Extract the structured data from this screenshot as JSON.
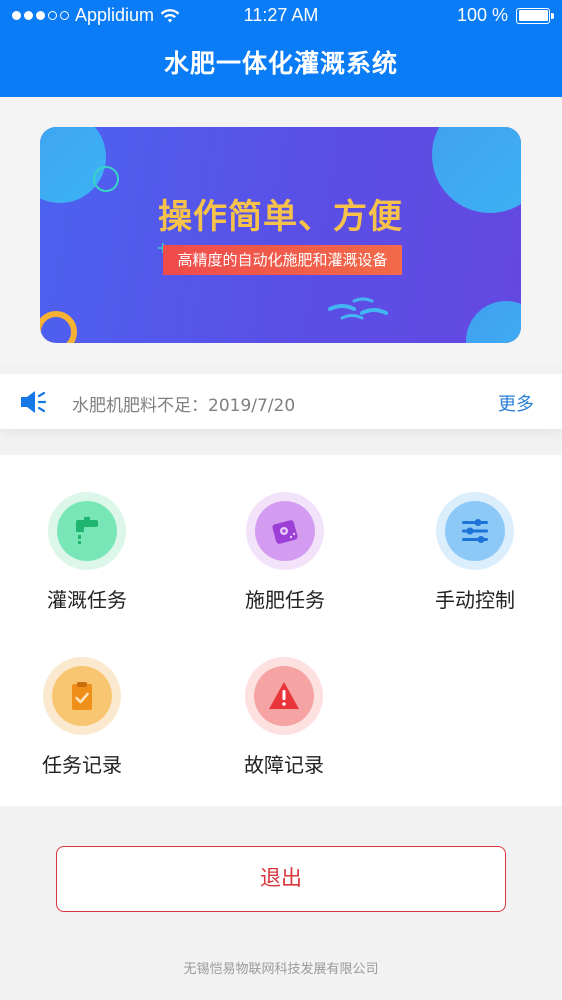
{
  "status_bar": {
    "carrier": "Applidium",
    "time": "11:27 AM",
    "battery": "100 %"
  },
  "header": {
    "title": "水肥一体化灌溉系统"
  },
  "banner": {
    "title": "操作简单、方便",
    "subtitle": "高精度的自动化施肥和灌溉设备"
  },
  "notice": {
    "icon": "speaker-icon",
    "message": "水肥机肥料不足：2019/7/20",
    "more": "更多"
  },
  "menu": [
    {
      "label": "灌溉任务",
      "icon": "faucet-icon"
    },
    {
      "label": "施肥任务",
      "icon": "fertilizer-icon"
    },
    {
      "label": "手动控制",
      "icon": "sliders-icon"
    },
    {
      "label": "任务记录",
      "icon": "clipboard-icon"
    },
    {
      "label": "故障记录",
      "icon": "warning-icon"
    }
  ],
  "logout_label": "退出",
  "footer": "无锡恺易物联网科技发展有限公司",
  "colors": {
    "header": "#0a7cf5",
    "accent_red": "#d9363e",
    "link_blue": "#2a7fd8",
    "banner_title": "#f7c24a"
  }
}
